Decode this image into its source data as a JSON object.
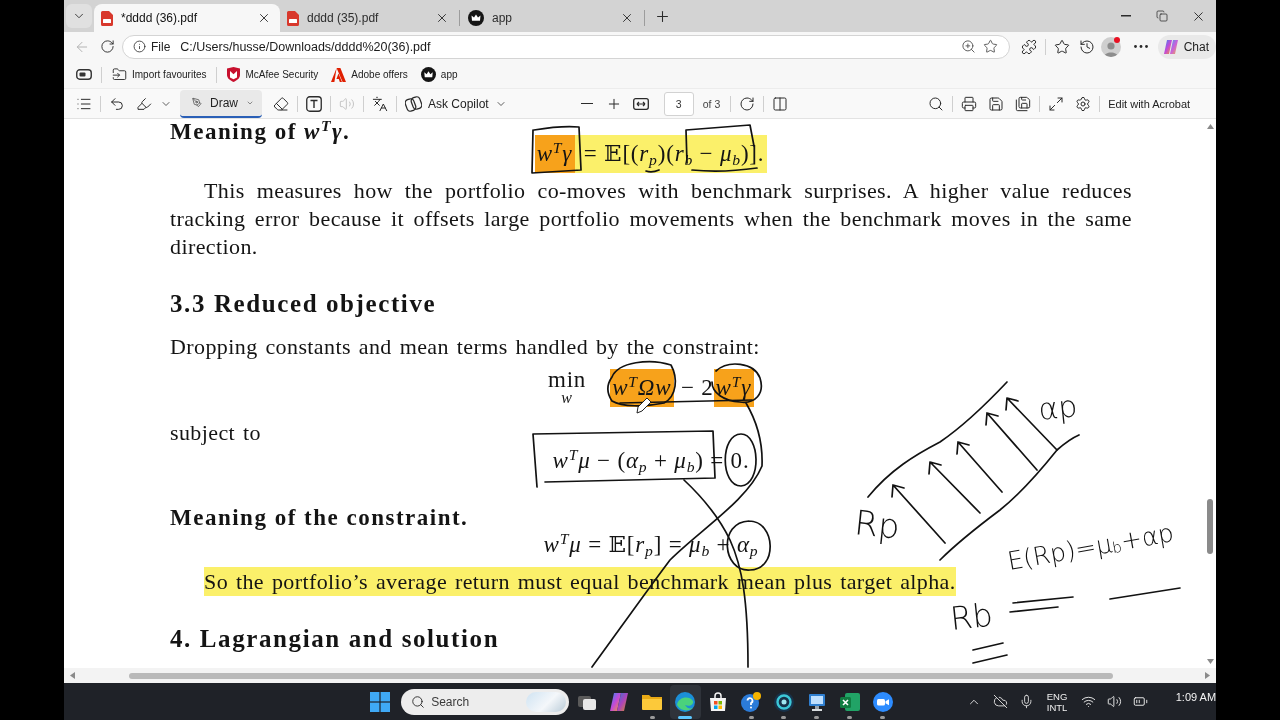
{
  "browser": {
    "tabs": [
      {
        "title": "*dddd (36).pdf",
        "kind": "pdf",
        "selected": true
      },
      {
        "title": "dddd (35).pdf",
        "kind": "pdf",
        "selected": false
      },
      {
        "title": "app",
        "kind": "app",
        "selected": false
      }
    ],
    "back": {
      "disabled": true
    },
    "address": {
      "scheme": "File",
      "url": "C:/Users/husse/Downloads/dddd%20(36).pdf"
    },
    "profile": {
      "notification": true
    },
    "chat": {
      "label": "Chat"
    }
  },
  "favorites": [
    {
      "label": "Import favourites"
    },
    {
      "label": "McAfee Security"
    },
    {
      "label": "Adobe offers"
    },
    {
      "label": "app"
    }
  ],
  "pdf_toolbar": {
    "draw": {
      "label": "Draw",
      "selected": true
    },
    "read_aloud": {
      "disabled": true
    },
    "copilot": {
      "label": "Ask Copilot"
    },
    "page": {
      "value": "3",
      "total": "of 3"
    },
    "edit": {
      "label": "Edit with Acrobat"
    }
  },
  "document": {
    "blocks": [
      {
        "kind": "run_in",
        "text": "Meaning of *w*$^{T}$*γ*."
      },
      {
        "kind": "formula",
        "parts": [
          {
            "text": "*w*$^{T}$*γ*",
            "color": "#f7a21b"
          },
          {
            "text": " = 𝔼[(*r*$_{p}$)(*r*$_{b}$ − *μ*$_{b}$)].",
            "color": "#fbf06a"
          }
        ]
      },
      {
        "kind": "paragraph",
        "text": "This measures how the portfolio co-moves with benchmark surprises. A higher value reduces tracking error because it offsets large portfolio movements when the benchmark moves in the same direction."
      },
      {
        "kind": "section",
        "text": "3.3 Reduced objective"
      },
      {
        "kind": "noindent",
        "text": "Dropping constants and mean terms handled by the constraint:"
      },
      {
        "kind": "formula",
        "parts": [
          {
            "text": "min",
            "below": "*w*"
          },
          {
            "text": "*w*$^{T}$*Ωw*",
            "color": "#f7a21b"
          },
          {
            "text": " − 2"
          },
          {
            "text": "*w*$^{T}$*γ*",
            "color": "#f7a21b"
          }
        ]
      },
      {
        "kind": "noindent",
        "text": "subject to"
      },
      {
        "kind": "formula",
        "parts": [
          {
            "text": "*w*$^{T}$*μ* − (*α*$_{p}$ + *μ*$_{b}$) = "
          },
          {
            "text": "0."
          }
        ]
      },
      {
        "kind": "run_in",
        "text": "Meaning of the constraint."
      },
      {
        "kind": "formula",
        "parts": [
          {
            "text": "*w*$^{T}$*μ* = 𝔼[*r*$_{p}$] = *μ*$_{b}$ + "
          },
          {
            "text": "*α*$_{p}$"
          }
        ]
      },
      {
        "kind": "paragraph",
        "text": "So the portfolio’s average return must equal benchmark mean plus target alpha.",
        "color": "#fbf06a"
      },
      {
        "kind": "section",
        "text": "4. Lagrangian and solution"
      }
    ]
  },
  "ink_notes": [
    {
      "text": "αp"
    },
    {
      "text": "Rp"
    },
    {
      "text": "E(Rp)=μ$_{b}$+αp"
    },
    {
      "text": "Rb"
    }
  ],
  "taskbar": {
    "search": {
      "placeholder": "Search"
    },
    "apps": [
      {
        "kind": "task_view",
        "running": false,
        "selected": false
      },
      {
        "kind": "ribbon",
        "running": false,
        "selected": false
      },
      {
        "kind": "folder",
        "running": true,
        "selected": false
      },
      {
        "kind": "swirl",
        "running": true,
        "selected": true
      },
      {
        "kind": "store",
        "running": false,
        "selected": false
      },
      {
        "kind": "help",
        "running": true,
        "selected": false
      },
      {
        "kind": "orb",
        "running": true,
        "selected": false
      },
      {
        "kind": "monitor",
        "running": true,
        "selected": false
      },
      {
        "kind": "spreadsheet",
        "running": true,
        "selected": false
      },
      {
        "kind": "camera",
        "running": true,
        "selected": false
      }
    ],
    "tray": {
      "language": "ENG",
      "layout": "INTL",
      "time": "1:09 AM"
    }
  }
}
